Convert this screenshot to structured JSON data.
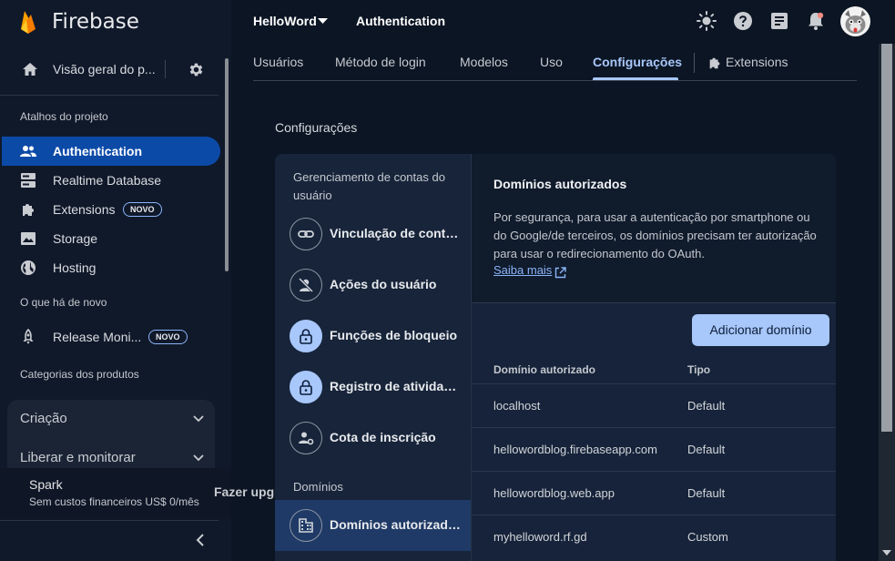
{
  "app": {
    "name": "Firebase"
  },
  "sidebar": {
    "overview_label": "Visão geral do p...",
    "shortcuts_label": "Atalhos do projeto",
    "shortcuts": [
      {
        "label": "Authentication",
        "icon": "people-icon",
        "active": true
      },
      {
        "label": "Realtime Database",
        "icon": "database-icon"
      },
      {
        "label": "Extensions",
        "icon": "extension-icon",
        "badge": "NOVO"
      },
      {
        "label": "Storage",
        "icon": "storage-icon"
      },
      {
        "label": "Hosting",
        "icon": "globe-icon"
      }
    ],
    "whats_new_label": "O que há de novo",
    "whats_new": [
      {
        "label": "Release Moni...",
        "icon": "rocket-icon",
        "badge": "NOVO"
      }
    ],
    "categories_label": "Categorias dos produtos",
    "categories": [
      "Criação",
      "Liberar e monitorar"
    ],
    "plan": {
      "name": "Spark",
      "description": "Sem custos financeiros US$ 0/mês"
    },
    "upgrade_label": "Fazer upgrade"
  },
  "header": {
    "project": "HelloWord",
    "page": "Authentication"
  },
  "tabs": [
    {
      "label": "Usuários"
    },
    {
      "label": "Método de login"
    },
    {
      "label": "Modelos"
    },
    {
      "label": "Uso"
    },
    {
      "label": "Configurações",
      "active": true
    },
    {
      "label": "Extensions"
    }
  ],
  "settings": {
    "title": "Configurações",
    "group_account": "Gerenciamento de contas do usuário",
    "menu": [
      {
        "label": "Vinculação de conta ...",
        "icon": "link-icon"
      },
      {
        "label": "Ações do usuário",
        "icon": "person-off-icon"
      },
      {
        "label": "Funções de bloqueio",
        "icon": "lock-icon"
      },
      {
        "label": "Registro de atividade...",
        "icon": "lock-icon"
      },
      {
        "label": "Cota de inscrição",
        "icon": "person-settings-icon"
      }
    ],
    "group_domains": "Domínios",
    "domains_item": {
      "label": "Domínios autorizados",
      "icon": "domain-icon"
    }
  },
  "domains": {
    "title": "Domínios autorizados",
    "description": "Por segurança, para usar a autenticação por smartphone ou do Google/de terceiros, os domínios precisam ter autorização para usar o redirecionamento do OAuth.",
    "learn_more": "Saiba mais",
    "add_button": "Adicionar domínio",
    "columns": [
      "Domínio autorizado",
      "Tipo"
    ],
    "rows": [
      [
        "localhost",
        "Default"
      ],
      [
        "hellowordblog.firebaseapp.com",
        "Default"
      ],
      [
        "hellowordblog.web.app",
        "Default"
      ],
      [
        "myhelloword.rf.gd",
        "Custom"
      ]
    ]
  },
  "colors": {
    "accent": "#a8c7fa",
    "active_nav": "#0c4aa8"
  }
}
